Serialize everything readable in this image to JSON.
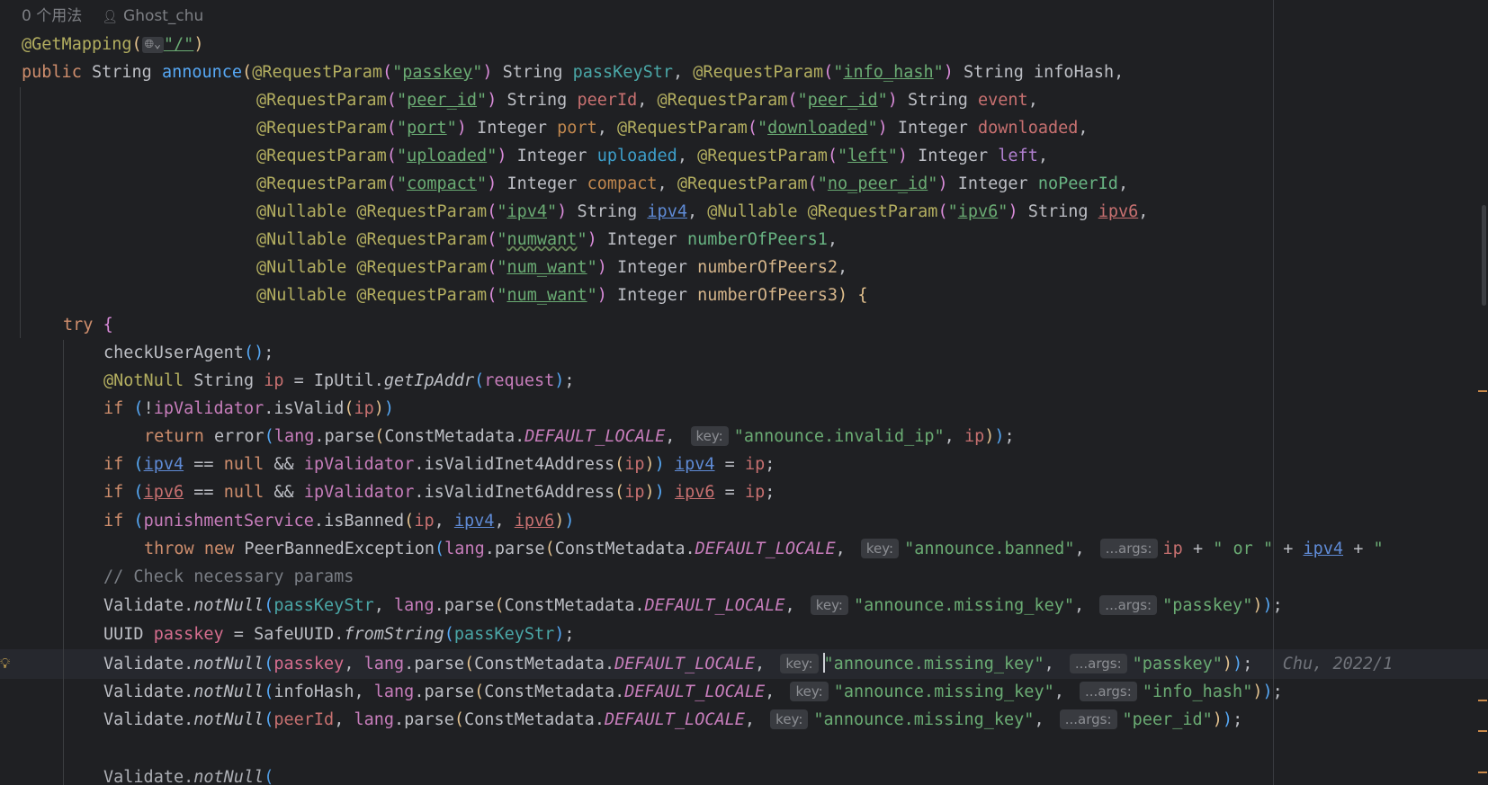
{
  "hint": {
    "usages": "0 个用法",
    "author": "Ghost_chu",
    "person_icon": "person-icon"
  },
  "code": {
    "getmapping": "@GetMapping",
    "path": "\"/\"",
    "public": "public",
    "string": "String",
    "integer": "Integer",
    "announce": "announce",
    "requestparam": "@RequestParam",
    "nullable": "@Nullable",
    "notnull": "@NotNull",
    "p_passkey": "passkey",
    "p_info_hash": "info_hash",
    "p_peer_id": "peer_id",
    "p_port": "port",
    "p_downloaded": "downloaded",
    "p_uploaded": "uploaded",
    "p_left": "left",
    "p_compact": "compact",
    "p_no_peer_id": "no_peer_id",
    "p_ipv4": "ipv4",
    "p_ipv6": "ipv6",
    "p_numwant": "numwant",
    "p_num_want": "num_want",
    "v_passKeyStr": "passKeyStr",
    "v_infoHash": "infoHash",
    "v_peerId": "peerId",
    "v_event": "event",
    "v_port": "port",
    "v_downloaded": "downloaded",
    "v_uploaded": "uploaded",
    "v_left": "left",
    "v_compact": "compact",
    "v_noPeerId": "noPeerId",
    "v_ipv4": "ipv4",
    "v_ipv6": "ipv6",
    "v_n1": "numberOfPeers1",
    "v_n2": "numberOfPeers2",
    "v_n3": "numberOfPeers3",
    "try": "try",
    "if": "if",
    "return": "return",
    "throw": "throw",
    "new": "new",
    "null": "null",
    "checkUserAgent": "checkUserAgent",
    "ip": "ip",
    "ipUtil": "IpUtil",
    "getIpAddr": "getIpAddr",
    "request": "request",
    "ipValidator": "ipValidator",
    "isValid": "isValid",
    "isValidInet4Address": "isValidInet4Address",
    "isValidInet6Address": "isValidInet6Address",
    "error": "error",
    "lang": "lang",
    "parse": "parse",
    "constMetadata": "ConstMetadata",
    "defaultLocale": "DEFAULT_LOCALE",
    "key_hint": "key:",
    "args_hint": "...args:",
    "s_invalid_ip": "\"announce.invalid_ip\"",
    "s_banned": "\"announce.banned\"",
    "s_or": "\" or \"",
    "s_quote": "\"",
    "s_missing_key": "\"announce.missing_key\"",
    "s_passkey": "\"passkey\"",
    "s_info_hash": "\"info_hash\"",
    "s_peer_id": "\"peer_id\"",
    "punishmentService": "punishmentService",
    "isBanned": "isBanned",
    "peerBannedException": "PeerBannedException",
    "comment": "// Check necessary params",
    "validate": "Validate",
    "notNull": "notNull",
    "uuid": "UUID",
    "passkey": "passkey",
    "safeUUID": "SafeUUID",
    "fromString": "fromString",
    "blame": "Chu, 2022/1"
  }
}
